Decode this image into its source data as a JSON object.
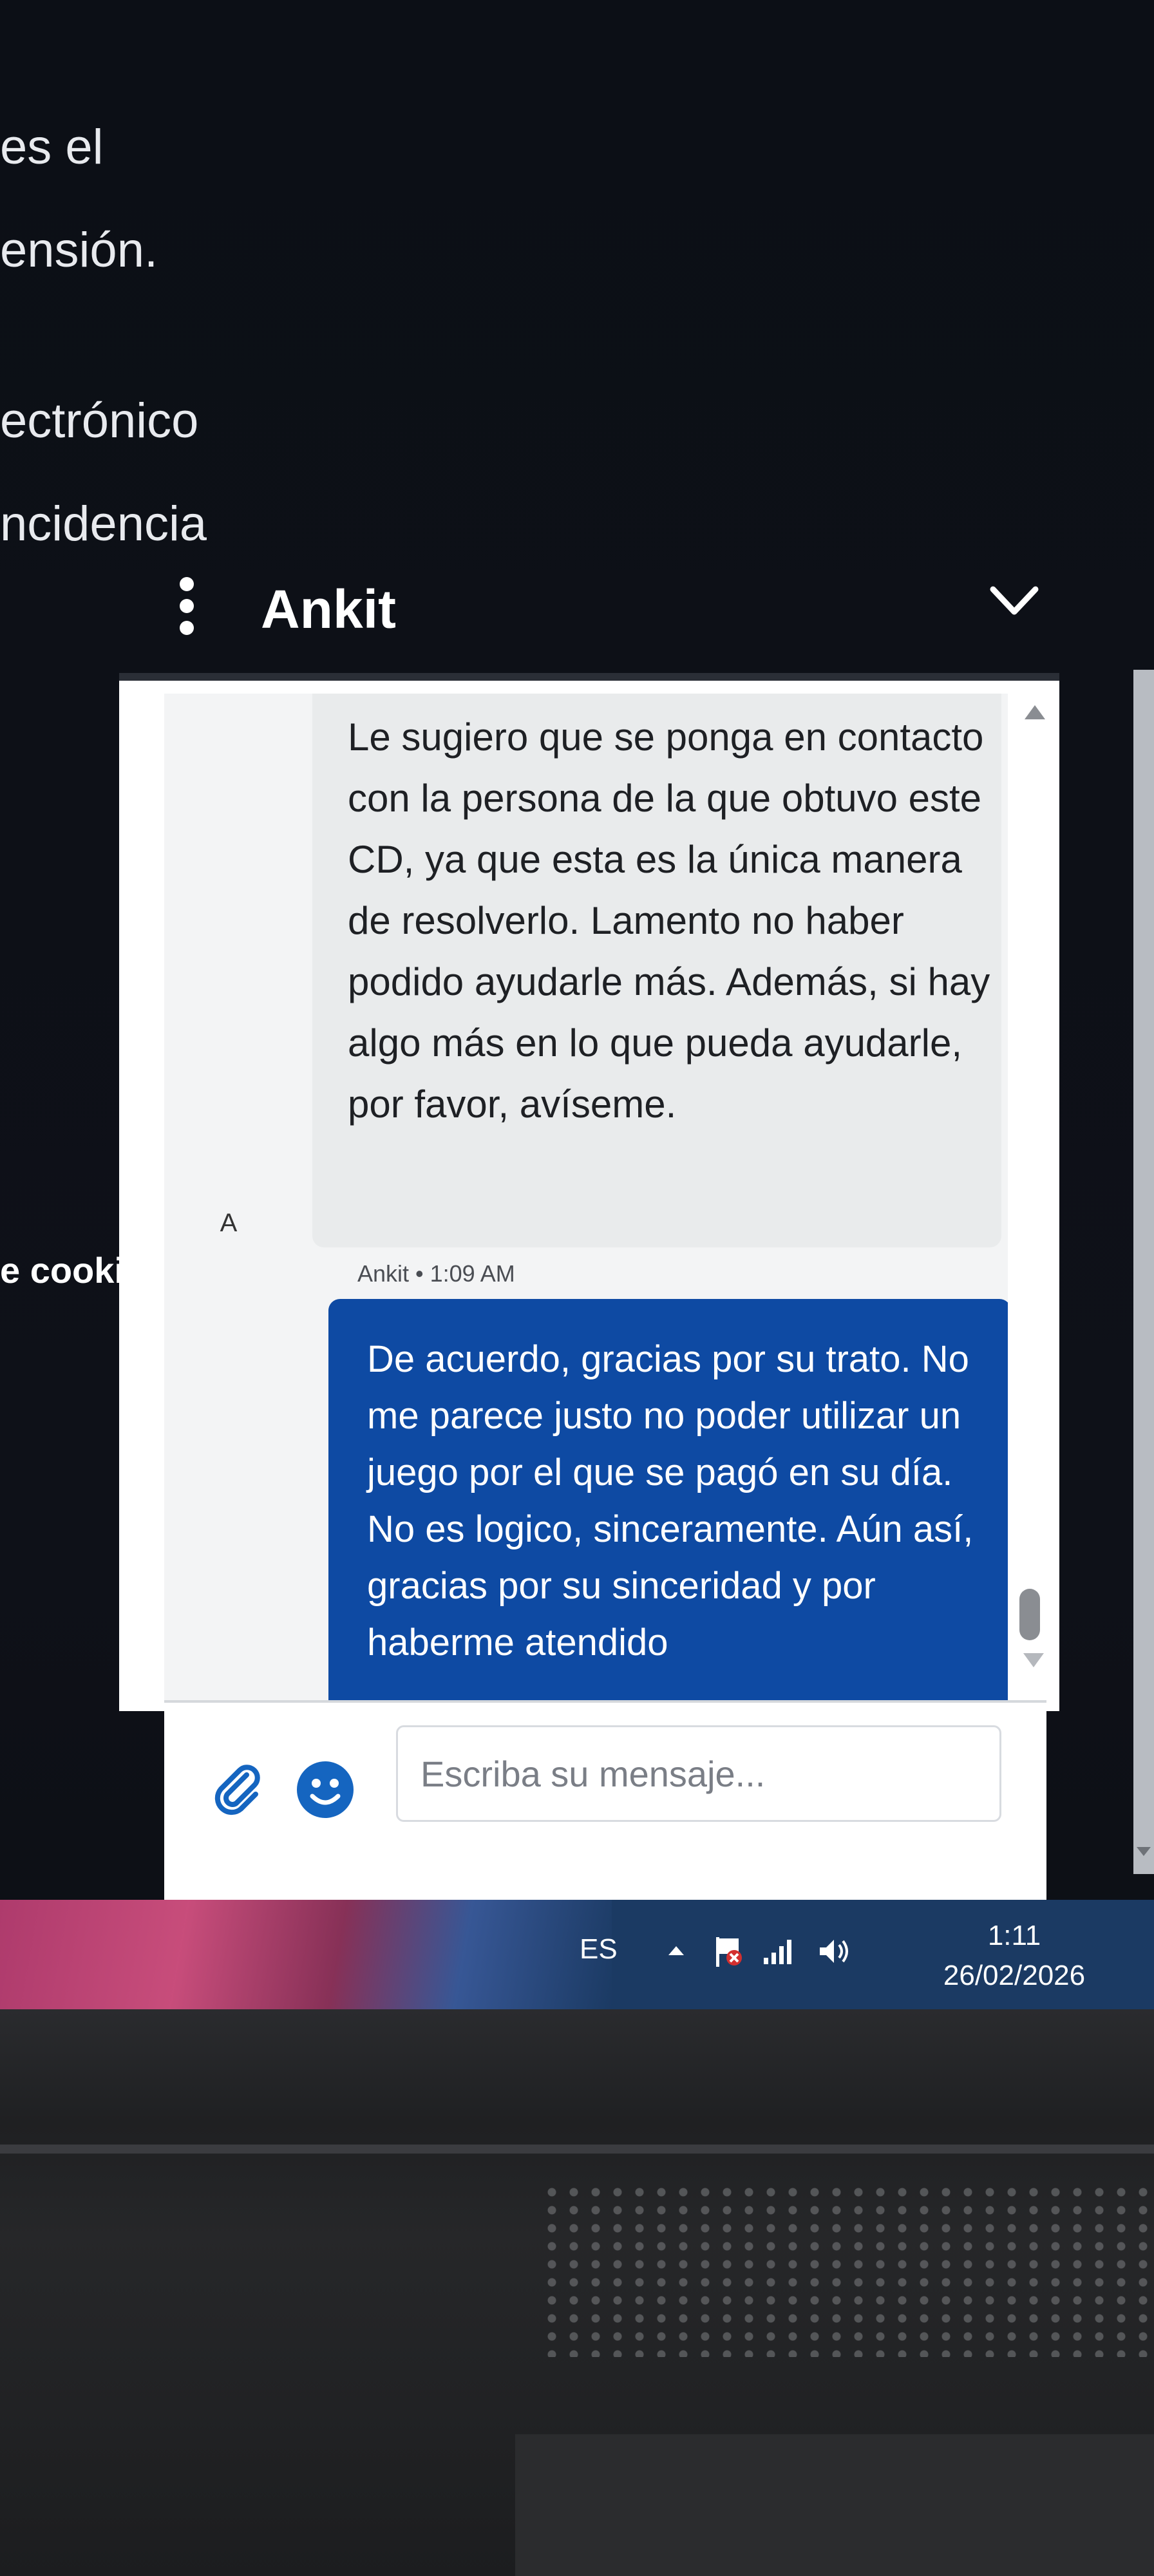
{
  "background_page": {
    "fragments": [
      "es el",
      "ensión.",
      "ectrónico",
      "ncidencia",
      "e cookie"
    ]
  },
  "chat": {
    "agent_name": "Ankit",
    "messages": [
      {
        "role": "agent",
        "avatar": "A",
        "text": "Le sugiero que se ponga en contacto con la persona de la que obtuvo este CD, ya que esta es la única manera de resolverlo. Lamento no haber podido ayudarle más. Además, si hay algo más en lo que pueda ayudarle, por favor, avíseme."
      },
      {
        "role": "user",
        "meta": "Ankit • 1:09 AM",
        "text": "De acuerdo, gracias por su trato. No me parece justo no poder utilizar un juego por el que se pagó en su día. No es logico, sinceramente. Aún así, gracias por su sinceridad y por haberme atendido"
      }
    ],
    "composer": {
      "placeholder": "Escriba su mensaje..."
    },
    "colors": {
      "user_bubble": "#0e4aa3",
      "agent_bubble": "#e9ebec",
      "icon_blue": "#1565c0"
    }
  },
  "taskbar": {
    "language": "ES",
    "time": "1:11",
    "date": "26/02/2026"
  },
  "icons": [
    "kebab-menu-icon",
    "chevron-down-icon",
    "attach-icon",
    "emoji-icon",
    "show-hidden-icons-icon",
    "flag-icon",
    "signal-icon",
    "volume-icon"
  ]
}
